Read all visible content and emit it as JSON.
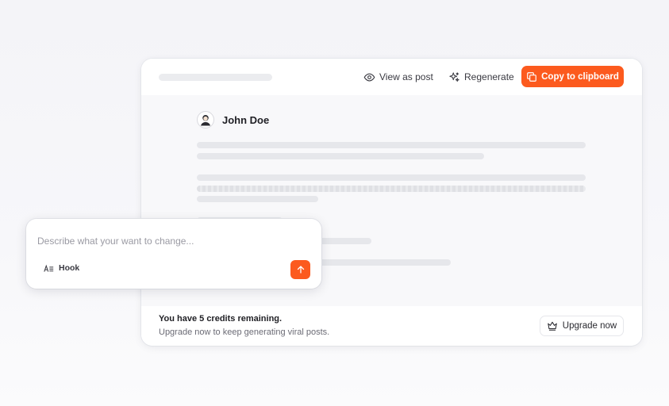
{
  "toolbar": {
    "view_as_post": "View as post",
    "regenerate": "Regenerate",
    "copy_to_clipboard": "Copy to clipboard"
  },
  "post": {
    "author_name": "John Doe"
  },
  "footer": {
    "credits_title": "You have 5 credits remaining.",
    "credits_subtitle": "Upgrade now to keep generating viral posts.",
    "upgrade_button": "Upgrade now"
  },
  "prompt": {
    "placeholder": "Describe what your want to change...",
    "hook_label": "Hook"
  },
  "icons": {
    "view": "eye-icon",
    "regenerate": "sparkles-icon",
    "copy": "copy-icon",
    "upgrade": "crown-icon",
    "hook": "text-format-icon",
    "send": "arrow-up-icon"
  },
  "colors": {
    "accent": "#fc5a1e",
    "skeleton": "#e6e7eb",
    "background": "#f5f5f8"
  }
}
